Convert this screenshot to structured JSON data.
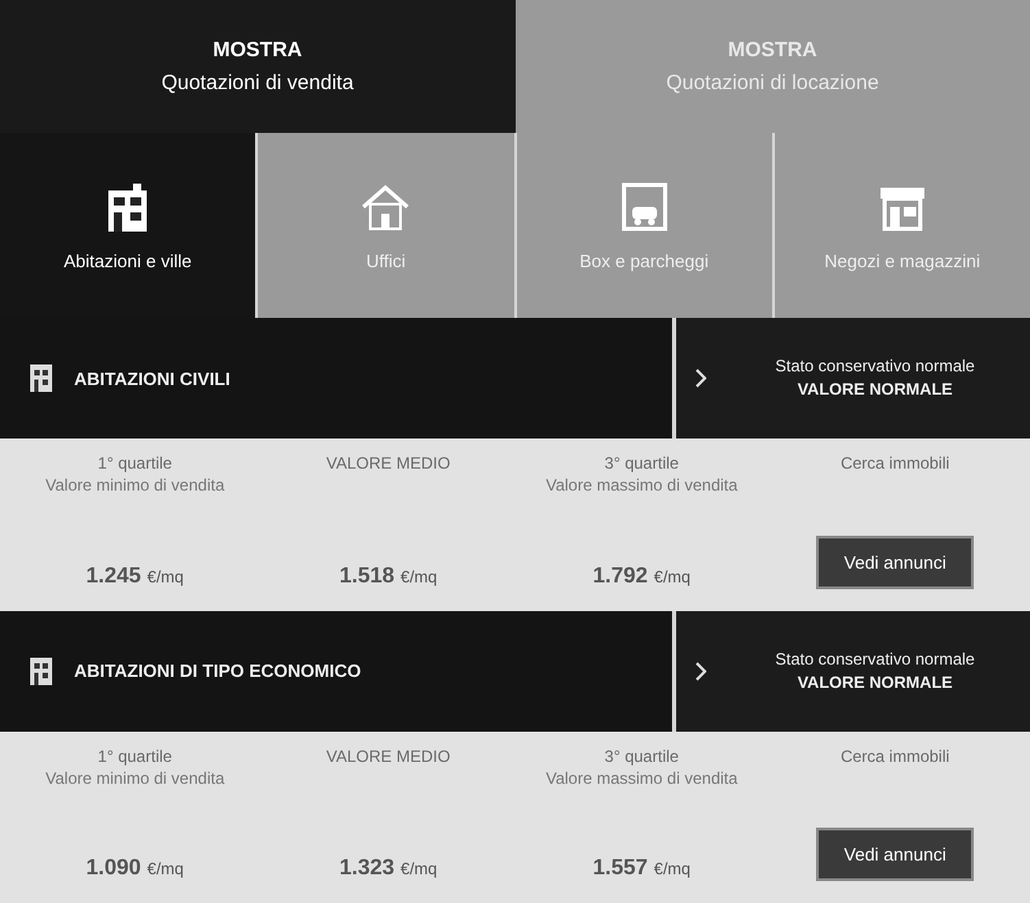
{
  "modes": [
    {
      "label": "MOSTRA",
      "sublabel": "Quotazioni di vendita",
      "selected": true
    },
    {
      "label": "MOSTRA",
      "sublabel": "Quotazioni di locazione",
      "selected": false
    }
  ],
  "categories": [
    {
      "label": "Abitazioni e ville",
      "selected": true
    },
    {
      "label": "Uffici",
      "selected": false
    },
    {
      "label": "Box e parcheggi",
      "selected": false
    },
    {
      "label": "Negozi e magazzini",
      "selected": false
    }
  ],
  "sections": [
    {
      "title": "ABITAZIONI CIVILI",
      "condition_label": "Stato conservativo normale",
      "condition_value": "VALORE NORMALE",
      "stats": [
        {
          "label": "1° quartile",
          "sublabel": "Valore minimo di vendita",
          "value": "1.245",
          "unit": "€/mq"
        },
        {
          "label": "VALORE MEDIO",
          "value": "1.518",
          "unit": "€/mq"
        },
        {
          "label": "3° quartile",
          "sublabel": "Valore massimo di vendita",
          "value": "1.792",
          "unit": "€/mq"
        }
      ],
      "action_label": "Cerca immobili",
      "button": "Vedi annunci"
    },
    {
      "title": "ABITAZIONI DI TIPO ECONOMICO",
      "condition_label": "Stato conservativo normale",
      "condition_value": "VALORE NORMALE",
      "stats": [
        {
          "label": "1° quartile",
          "sublabel": "Valore minimo di vendita",
          "value": "1.090",
          "unit": "€/mq"
        },
        {
          "label": "VALORE MEDIO",
          "value": "1.323",
          "unit": "€/mq"
        },
        {
          "label": "3° quartile",
          "sublabel": "Valore massimo di vendita",
          "value": "1.557",
          "unit": "€/mq"
        }
      ],
      "action_label": "Cerca immobili",
      "button": "Vedi annunci"
    }
  ]
}
